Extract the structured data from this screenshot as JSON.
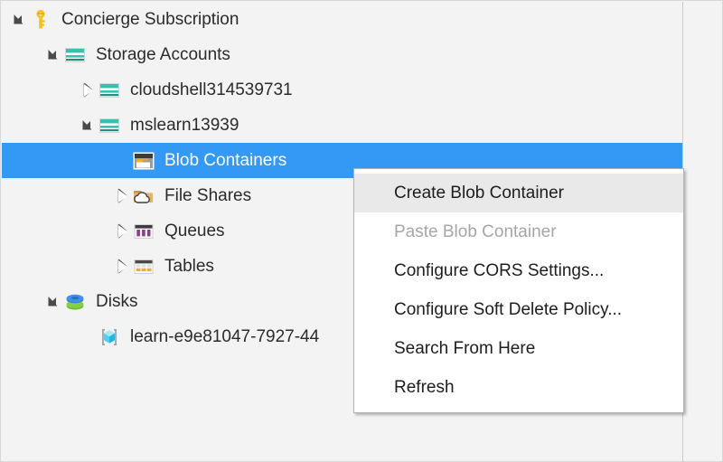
{
  "tree": {
    "name": "storage-explorer-tree",
    "items": [
      {
        "label": "Concierge Subscription",
        "icon": "key-icon",
        "state": "expanded",
        "depth": 0,
        "selected": false
      },
      {
        "label": "Storage Accounts",
        "icon": "storage-accounts-icon",
        "state": "expanded",
        "depth": 1,
        "selected": false
      },
      {
        "label": "cloudshell314539731",
        "icon": "storage-account-icon",
        "state": "collapsed",
        "depth": 2,
        "selected": false
      },
      {
        "label": "mslearn13939",
        "icon": "storage-account-icon",
        "state": "expanded",
        "depth": 2,
        "selected": false
      },
      {
        "label": "Blob Containers",
        "icon": "blob-container-icon",
        "state": "none",
        "depth": 3,
        "selected": true
      },
      {
        "label": "File Shares",
        "icon": "file-shares-icon",
        "state": "collapsed",
        "depth": 3,
        "selected": false
      },
      {
        "label": "Queues",
        "icon": "queues-icon",
        "state": "collapsed",
        "depth": 3,
        "selected": false
      },
      {
        "label": "Tables",
        "icon": "tables-icon",
        "state": "collapsed",
        "depth": 3,
        "selected": false
      },
      {
        "label": "Disks",
        "icon": "disks-icon",
        "state": "expanded",
        "depth": 1,
        "selected": false
      },
      {
        "label": "learn-e9e81047-7927-44",
        "icon": "disk-item-icon",
        "state": "none",
        "depth": 2,
        "selected": false
      }
    ]
  },
  "context_menu": {
    "name": "blob-containers-context-menu",
    "items": [
      {
        "label": "Create Blob Container",
        "state": "highlighted"
      },
      {
        "label": "Paste Blob Container",
        "state": "disabled"
      },
      {
        "label": "Configure CORS Settings...",
        "state": "normal"
      },
      {
        "label": "Configure Soft Delete Policy...",
        "state": "normal"
      },
      {
        "label": "Search From Here",
        "state": "normal"
      },
      {
        "label": "Refresh",
        "state": "normal"
      }
    ]
  },
  "colors": {
    "selection_blue": "#3399f5",
    "panel_background": "#f3f3f3",
    "menu_background": "#ffffff",
    "menu_highlight": "#e9e9e9",
    "disabled_text": "#a6a6a6",
    "storage_teal": "#36c1b0",
    "key_gold": "#fcbf20",
    "queue_purple": "#923a8d",
    "fileshare_tan": "#e3b46d",
    "table_amber": "#f2b01e",
    "disk_blue": "#2f7fdb",
    "disk_green": "#6fbd2f",
    "cube_cyan": "#4fd2f0"
  }
}
